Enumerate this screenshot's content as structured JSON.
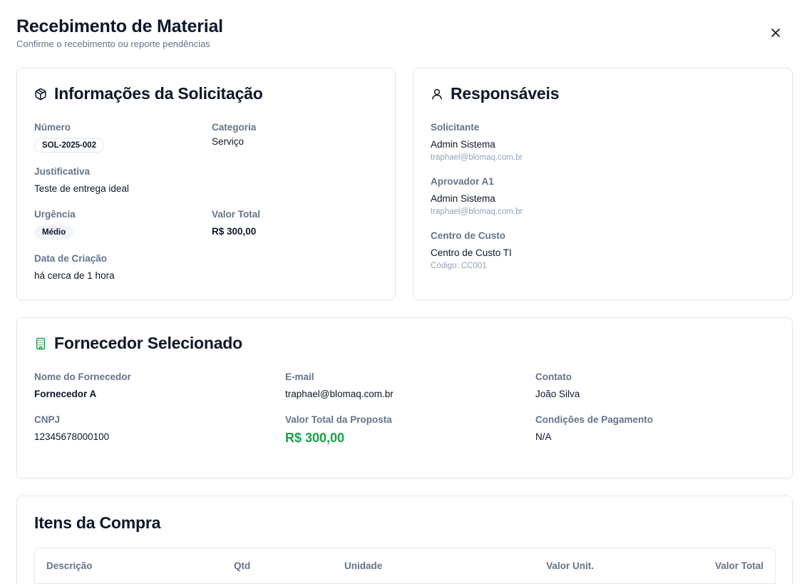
{
  "dialog": {
    "title": "Recebimento de Material",
    "subtitle": "Confirme o recebimento ou reporte pendências",
    "close_icon": "close-icon"
  },
  "info": {
    "title": "Informações da Solicitação",
    "icon": "package-icon",
    "numero_label": "Número",
    "numero_value": "SOL-2025-002",
    "categoria_label": "Categoria",
    "categoria_value": "Serviço",
    "justificativa_label": "Justificativa",
    "justificativa_value": "Teste de entrega ideal",
    "urgencia_label": "Urgência",
    "urgencia_value": "Médio",
    "valor_label": "Valor Total",
    "valor_value": "R$ 300,00",
    "data_label": "Data de Criação",
    "data_value": "há cerca de 1 hora"
  },
  "responsaveis": {
    "title": "Responsáveis",
    "icon": "user-icon",
    "solicitante_label": "Solicitante",
    "solicitante_name": "Admin Sistema",
    "solicitante_email": "traphael@blomaq.com.br",
    "aprovador_label": "Aprovador A1",
    "aprovador_name": "Admin Sistema",
    "aprovador_email": "traphael@blomaq.com.br",
    "centro_label": "Centro de Custo",
    "centro_name": "Centro de Custo TI",
    "centro_code": "Código: CC001"
  },
  "fornecedor": {
    "title": "Fornecedor Selecionado",
    "icon": "building-icon",
    "nome_label": "Nome do Fornecedor",
    "nome_value": "Fornecedor A",
    "email_label": "E-mail",
    "email_value": "traphael@blomaq.com.br",
    "contato_label": "Contato",
    "contato_value": "João Silva",
    "cnpj_label": "CNPJ",
    "cnpj_value": "12345678000100",
    "valor_label": "Valor Total da Proposta",
    "valor_value": "R$ 300,00",
    "condicoes_label": "Condições de Pagamento",
    "condicoes_value": "N/A"
  },
  "itens": {
    "title": "Itens da Compra",
    "columns": [
      "Descrição",
      "Qtd",
      "Unidade",
      "Valor Unit.",
      "Valor Total"
    ]
  },
  "colors": {
    "accent_green": "#16a34a",
    "muted": "#64748b",
    "border": "#e2e8f0"
  }
}
